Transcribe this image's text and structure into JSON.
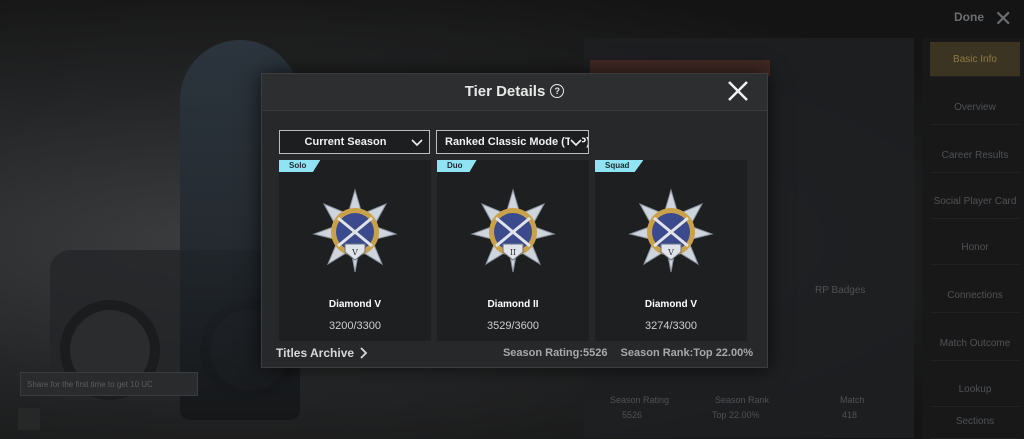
{
  "background": {
    "top_right_label": "Done",
    "menu_items": [
      "Basic Info",
      "Overview",
      "Career Results",
      "Social Player Card",
      "Honor",
      "Connections",
      "Match Outcome",
      "Lookup",
      "Sections"
    ],
    "vehicle_label": "RP Badges",
    "season_stats": [
      {
        "label": "Season Rating",
        "value": "5526"
      },
      {
        "label": "Season Rank",
        "value": "Top 22.00%"
      },
      {
        "label": "Match",
        "value": "418"
      }
    ],
    "toast": "Share for the first time to get 10 UC"
  },
  "dialog": {
    "title": "Tier Details",
    "season_dropdown": "Current Season",
    "mode_dropdown": "Ranked Classic Mode (TPP)",
    "cards": [
      {
        "tag": "Solo",
        "tier": "Diamond V",
        "numeral": "V",
        "points": "3200/3300"
      },
      {
        "tag": "Duo",
        "tier": "Diamond II",
        "numeral": "II",
        "points": "3529/3600"
      },
      {
        "tag": "Squad",
        "tier": "Diamond V",
        "numeral": "V",
        "points": "3274/3300"
      }
    ],
    "footer": {
      "titles_archive": "Titles Archive",
      "season_rating": "Season Rating:5526",
      "season_rank": "Season Rank:Top 22.00%"
    }
  },
  "colors": {
    "tag_bg": "#8fe3f2",
    "badge_blue": "#3b4a8c",
    "badge_gold": "#c9a14a",
    "badge_silver": "#cfd5dd"
  },
  "icons": {
    "help": "question-circle-icon",
    "close": "close-icon",
    "chevron": "chevron-down-icon",
    "arrow": "chevron-right-icon"
  }
}
